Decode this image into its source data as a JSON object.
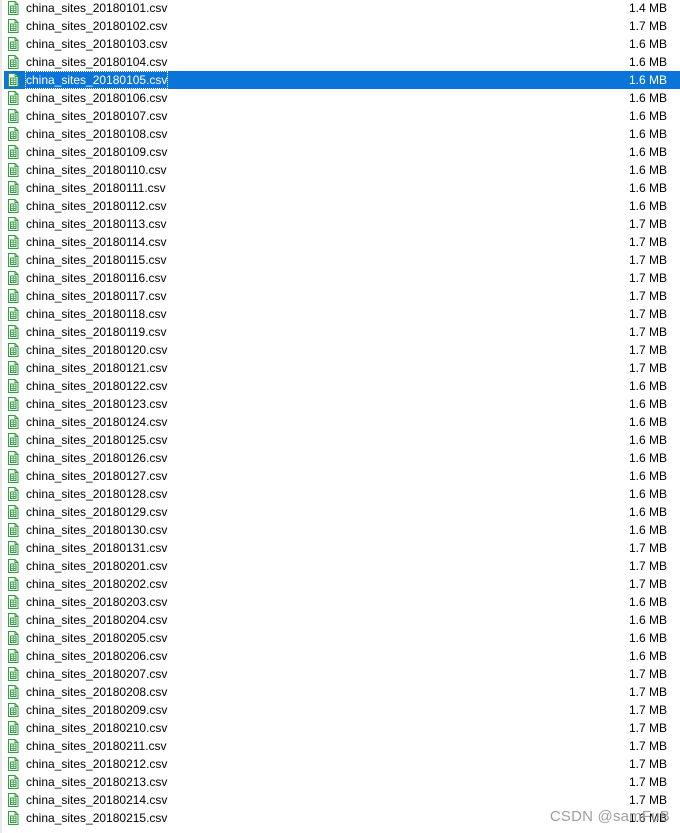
{
  "files": [
    {
      "name": "china_sites_20180101.csv",
      "size": "1.4 MB",
      "selected": false
    },
    {
      "name": "china_sites_20180102.csv",
      "size": "1.7 MB",
      "selected": false
    },
    {
      "name": "china_sites_20180103.csv",
      "size": "1.6 MB",
      "selected": false
    },
    {
      "name": "china_sites_20180104.csv",
      "size": "1.6 MB",
      "selected": false
    },
    {
      "name": "china_sites_20180105.csv",
      "size": "1.6 MB",
      "selected": true
    },
    {
      "name": "china_sites_20180106.csv",
      "size": "1.6 MB",
      "selected": false
    },
    {
      "name": "china_sites_20180107.csv",
      "size": "1.6 MB",
      "selected": false
    },
    {
      "name": "china_sites_20180108.csv",
      "size": "1.6 MB",
      "selected": false
    },
    {
      "name": "china_sites_20180109.csv",
      "size": "1.6 MB",
      "selected": false
    },
    {
      "name": "china_sites_20180110.csv",
      "size": "1.6 MB",
      "selected": false
    },
    {
      "name": "china_sites_20180111.csv",
      "size": "1.6 MB",
      "selected": false
    },
    {
      "name": "china_sites_20180112.csv",
      "size": "1.6 MB",
      "selected": false
    },
    {
      "name": "china_sites_20180113.csv",
      "size": "1.7 MB",
      "selected": false
    },
    {
      "name": "china_sites_20180114.csv",
      "size": "1.7 MB",
      "selected": false
    },
    {
      "name": "china_sites_20180115.csv",
      "size": "1.7 MB",
      "selected": false
    },
    {
      "name": "china_sites_20180116.csv",
      "size": "1.7 MB",
      "selected": false
    },
    {
      "name": "china_sites_20180117.csv",
      "size": "1.7 MB",
      "selected": false
    },
    {
      "name": "china_sites_20180118.csv",
      "size": "1.7 MB",
      "selected": false
    },
    {
      "name": "china_sites_20180119.csv",
      "size": "1.7 MB",
      "selected": false
    },
    {
      "name": "china_sites_20180120.csv",
      "size": "1.7 MB",
      "selected": false
    },
    {
      "name": "china_sites_20180121.csv",
      "size": "1.7 MB",
      "selected": false
    },
    {
      "name": "china_sites_20180122.csv",
      "size": "1.6 MB",
      "selected": false
    },
    {
      "name": "china_sites_20180123.csv",
      "size": "1.6 MB",
      "selected": false
    },
    {
      "name": "china_sites_20180124.csv",
      "size": "1.6 MB",
      "selected": false
    },
    {
      "name": "china_sites_20180125.csv",
      "size": "1.6 MB",
      "selected": false
    },
    {
      "name": "china_sites_20180126.csv",
      "size": "1.6 MB",
      "selected": false
    },
    {
      "name": "china_sites_20180127.csv",
      "size": "1.6 MB",
      "selected": false
    },
    {
      "name": "china_sites_20180128.csv",
      "size": "1.6 MB",
      "selected": false
    },
    {
      "name": "china_sites_20180129.csv",
      "size": "1.6 MB",
      "selected": false
    },
    {
      "name": "china_sites_20180130.csv",
      "size": "1.6 MB",
      "selected": false
    },
    {
      "name": "china_sites_20180131.csv",
      "size": "1.7 MB",
      "selected": false
    },
    {
      "name": "china_sites_20180201.csv",
      "size": "1.7 MB",
      "selected": false
    },
    {
      "name": "china_sites_20180202.csv",
      "size": "1.7 MB",
      "selected": false
    },
    {
      "name": "china_sites_20180203.csv",
      "size": "1.6 MB",
      "selected": false
    },
    {
      "name": "china_sites_20180204.csv",
      "size": "1.6 MB",
      "selected": false
    },
    {
      "name": "china_sites_20180205.csv",
      "size": "1.6 MB",
      "selected": false
    },
    {
      "name": "china_sites_20180206.csv",
      "size": "1.6 MB",
      "selected": false
    },
    {
      "name": "china_sites_20180207.csv",
      "size": "1.7 MB",
      "selected": false
    },
    {
      "name": "china_sites_20180208.csv",
      "size": "1.7 MB",
      "selected": false
    },
    {
      "name": "china_sites_20180209.csv",
      "size": "1.7 MB",
      "selected": false
    },
    {
      "name": "china_sites_20180210.csv",
      "size": "1.7 MB",
      "selected": false
    },
    {
      "name": "china_sites_20180211.csv",
      "size": "1.7 MB",
      "selected": false
    },
    {
      "name": "china_sites_20180212.csv",
      "size": "1.7 MB",
      "selected": false
    },
    {
      "name": "china_sites_20180213.csv",
      "size": "1.7 MB",
      "selected": false
    },
    {
      "name": "china_sites_20180214.csv",
      "size": "1.7 MB",
      "selected": false
    },
    {
      "name": "china_sites_20180215.csv",
      "size": "1.6 MB",
      "selected": false
    }
  ],
  "watermark": "CSDN @samFuB",
  "colors": {
    "selection": "#0b74d8",
    "icon_green": "#2e9e3e"
  },
  "icon": "csv-file-icon"
}
